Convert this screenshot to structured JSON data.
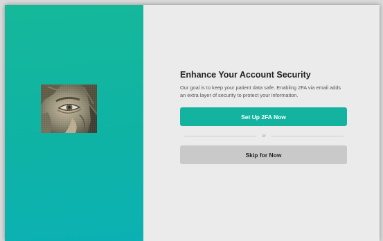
{
  "brand": {
    "gradient_top": "#16b89a",
    "gradient_bottom": "#0bb1b3",
    "primary_button_color": "#14b3a0",
    "secondary_button_color": "#c9c9c9"
  },
  "image": {
    "icon": "mosaic-eye-image"
  },
  "content": {
    "title": "Enhance Your Account Security",
    "description": "Our goal is to keep your patient data safe. Enabling 2FA via email adds an extra layer of security to protect your information.",
    "primary_button": "Set Up 2FA Now",
    "divider_text": "or",
    "secondary_button": "Skip for Now"
  }
}
